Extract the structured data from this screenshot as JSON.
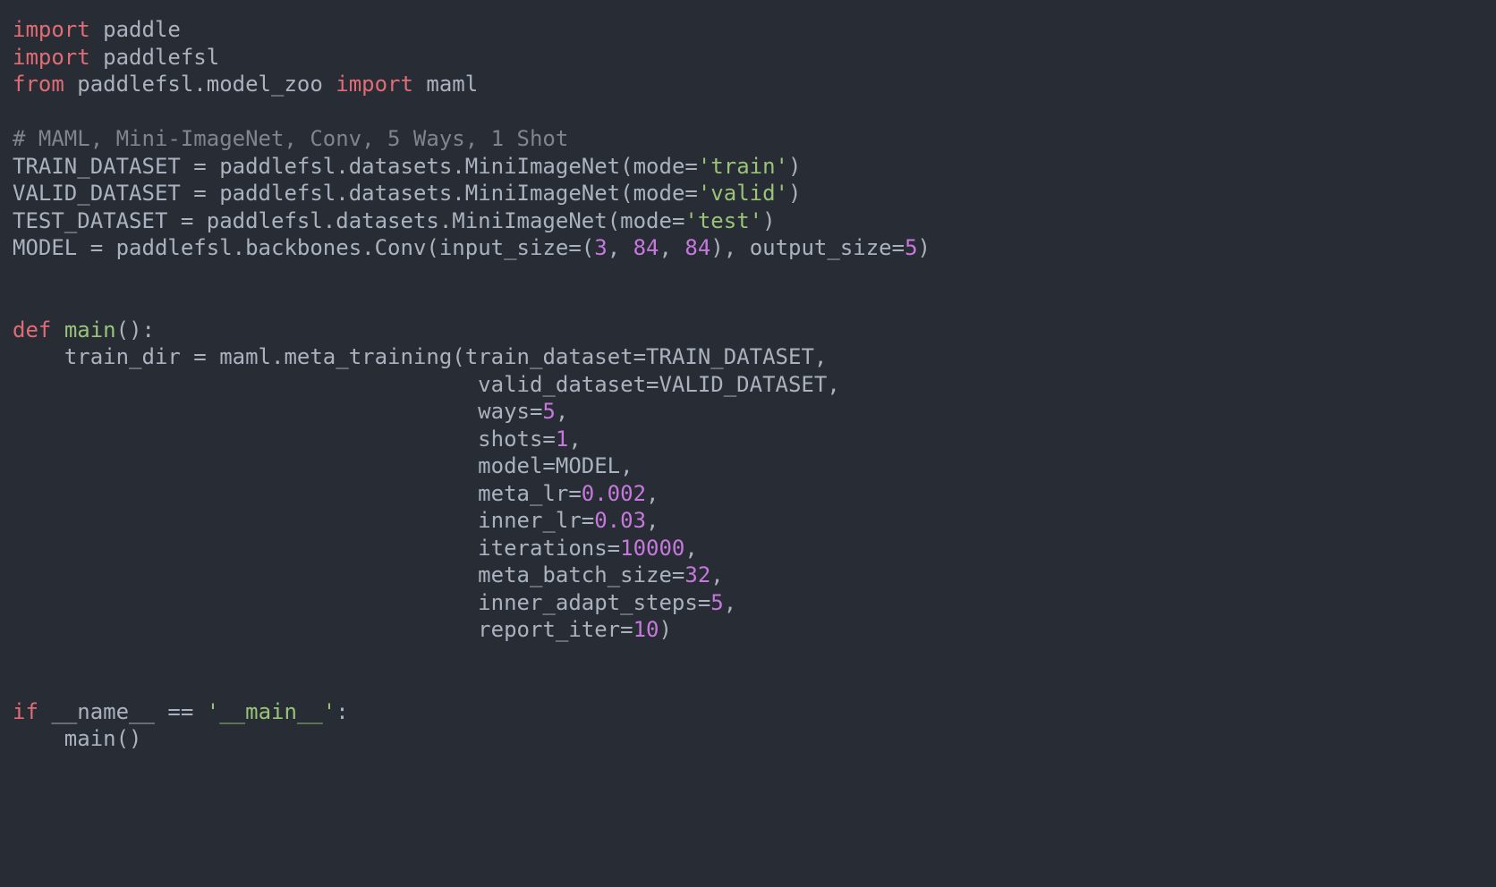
{
  "code": {
    "lines": [
      {
        "type": "import",
        "kw1": "import",
        "mod": "paddle"
      },
      {
        "type": "import",
        "kw1": "import",
        "mod": "paddlefsl"
      },
      {
        "type": "fromimport",
        "kw1": "from",
        "mod": "paddlefsl.model_zoo",
        "kw2": "import",
        "name": "maml"
      },
      {
        "type": "blank"
      },
      {
        "type": "comment",
        "text": "# MAML, Mini-ImageNet, Conv, 5 Ways, 1 Shot"
      },
      {
        "type": "assign_call",
        "lhs": "TRAIN_DATASET",
        "call": "paddlefsl.datasets.MiniImageNet",
        "args": [
          {
            "k": "mode",
            "vstr": "'train'"
          }
        ]
      },
      {
        "type": "assign_call",
        "lhs": "VALID_DATASET",
        "call": "paddlefsl.datasets.MiniImageNet",
        "args": [
          {
            "k": "mode",
            "vstr": "'valid'"
          }
        ]
      },
      {
        "type": "assign_call",
        "lhs": "TEST_DATASET",
        "call": "paddlefsl.datasets.MiniImageNet",
        "args": [
          {
            "k": "mode",
            "vstr": "'test'"
          }
        ]
      },
      {
        "type": "assign_call",
        "lhs": "MODEL",
        "call": "paddlefsl.backbones.Conv",
        "args": [
          {
            "k": "input_size",
            "vtuple": [
              "3",
              "84",
              "84"
            ]
          },
          {
            "k": "output_size",
            "vnum": "5"
          }
        ]
      },
      {
        "type": "blank"
      },
      {
        "type": "blank"
      },
      {
        "type": "def",
        "kw": "def",
        "name": "main",
        "params": ""
      },
      {
        "type": "assign_multicall",
        "indent": "    ",
        "lhs": "train_dir",
        "call": "maml.meta_training",
        "first_arg": {
          "k": "train_dataset",
          "vid": "TRAIN_DATASET"
        }
      },
      {
        "type": "cont_arg",
        "indent": "                                    ",
        "arg": {
          "k": "valid_dataset",
          "vid": "VALID_DATASET"
        }
      },
      {
        "type": "cont_arg",
        "indent": "                                    ",
        "arg": {
          "k": "ways",
          "vnum": "5"
        }
      },
      {
        "type": "cont_arg",
        "indent": "                                    ",
        "arg": {
          "k": "shots",
          "vnum": "1"
        }
      },
      {
        "type": "cont_arg",
        "indent": "                                    ",
        "arg": {
          "k": "model",
          "vid": "MODEL"
        }
      },
      {
        "type": "cont_arg",
        "indent": "                                    ",
        "arg": {
          "k": "meta_lr",
          "vnum": "0.002"
        }
      },
      {
        "type": "cont_arg",
        "indent": "                                    ",
        "arg": {
          "k": "inner_lr",
          "vnum": "0.03"
        }
      },
      {
        "type": "cont_arg",
        "indent": "                                    ",
        "arg": {
          "k": "iterations",
          "vnum": "10000"
        }
      },
      {
        "type": "cont_arg",
        "indent": "                                    ",
        "arg": {
          "k": "meta_batch_size",
          "vnum": "32"
        }
      },
      {
        "type": "cont_arg",
        "indent": "                                    ",
        "arg": {
          "k": "inner_adapt_steps",
          "vnum": "5"
        }
      },
      {
        "type": "cont_arg_last",
        "indent": "                                    ",
        "arg": {
          "k": "report_iter",
          "vnum": "10"
        }
      },
      {
        "type": "blank"
      },
      {
        "type": "blank"
      },
      {
        "type": "ifmain",
        "kw": "if",
        "dunder": "__name__",
        "op": "==",
        "str": "'__main__'"
      },
      {
        "type": "callstmt",
        "indent": "    ",
        "call": "main",
        "args": ""
      }
    ]
  }
}
